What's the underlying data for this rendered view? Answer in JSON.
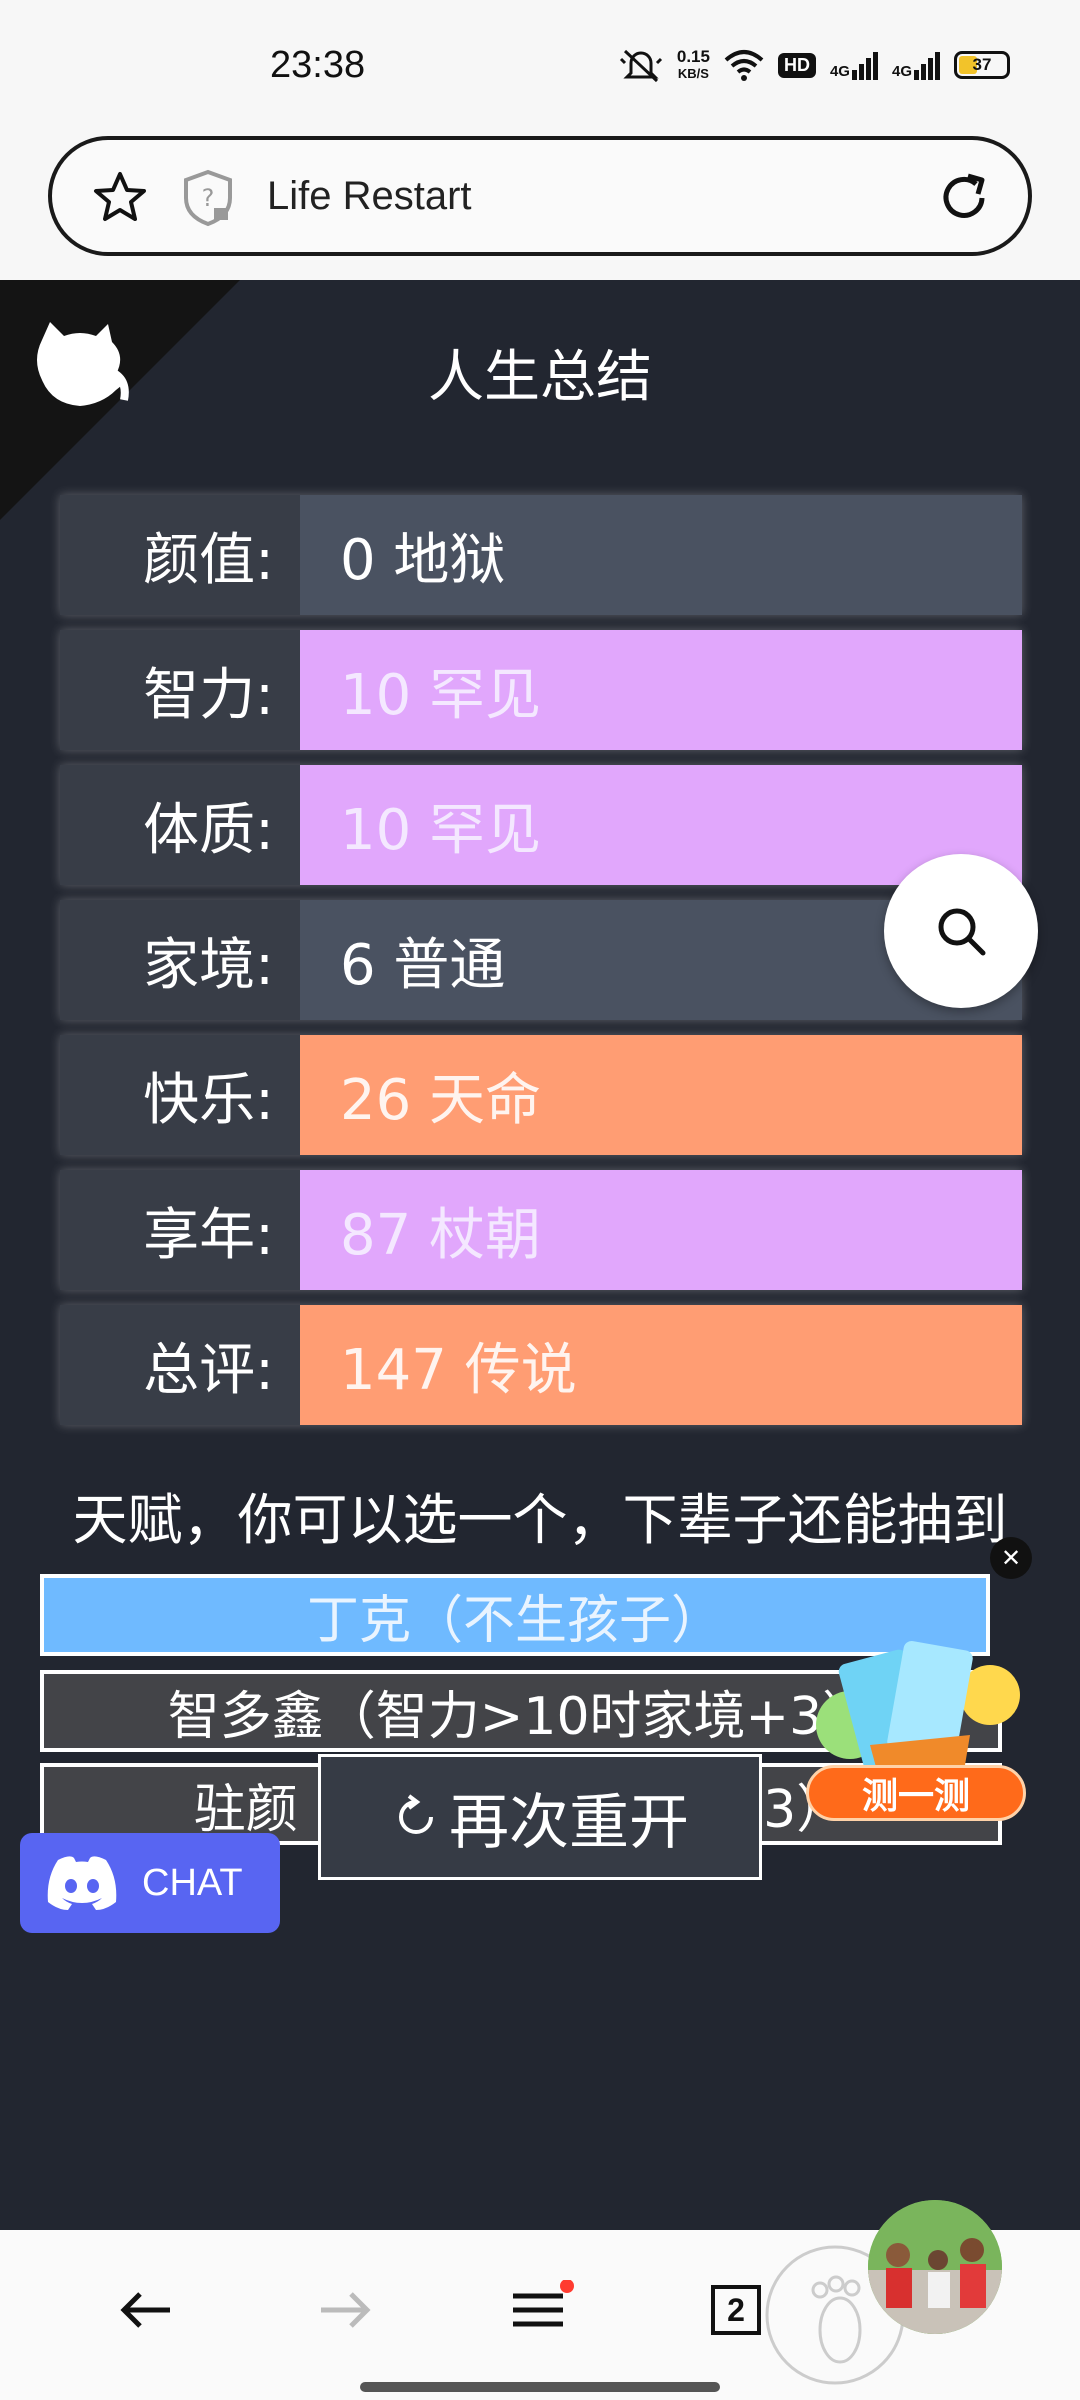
{
  "status_bar": {
    "time": "23:38",
    "net_speed_value": "0.15",
    "net_speed_unit": "KB/S",
    "hd_badge": "HD",
    "network_1": "4G",
    "network_2": "4G",
    "battery": "37"
  },
  "address_bar": {
    "title": "Life Restart"
  },
  "game": {
    "title": "人生总结",
    "properties": [
      {
        "label": "颜值:",
        "value": "0 地狱",
        "grade": "gray"
      },
      {
        "label": "智力:",
        "value": "10 罕见",
        "grade": "purple"
      },
      {
        "label": "体质:",
        "value": "10 罕见",
        "grade": "purple"
      },
      {
        "label": "家境:",
        "value": "6 普通",
        "grade": "gray"
      },
      {
        "label": "快乐:",
        "value": "26 天命",
        "grade": "orange"
      },
      {
        "label": "享年:",
        "value": "87 杖朝",
        "grade": "purple"
      },
      {
        "label": "总评:",
        "value": "147 传说",
        "grade": "orange"
      }
    ],
    "talent_header": "天赋，你可以选一个，下辈子还能抽到",
    "talents": [
      {
        "label": "丁克（不生孩子）",
        "selected": true
      },
      {
        "label": "智多鑫（智力>10时家境+3）",
        "selected": false
      },
      {
        "label": "驻颜（体质>10时颜值+3）",
        "selected": false
      }
    ],
    "restart_label": "再次重开",
    "promo_label": "测一测",
    "chat_label": "CHAT"
  },
  "nav": {
    "tab_count": "2"
  },
  "colors": {
    "bg": "#222630",
    "label_bg": "#383d47",
    "gray": "#4a5261",
    "purple": "#e1a7fc",
    "orange": "#ff9d73",
    "selected_talent": "#6fbaff",
    "discord": "#5865f2"
  }
}
